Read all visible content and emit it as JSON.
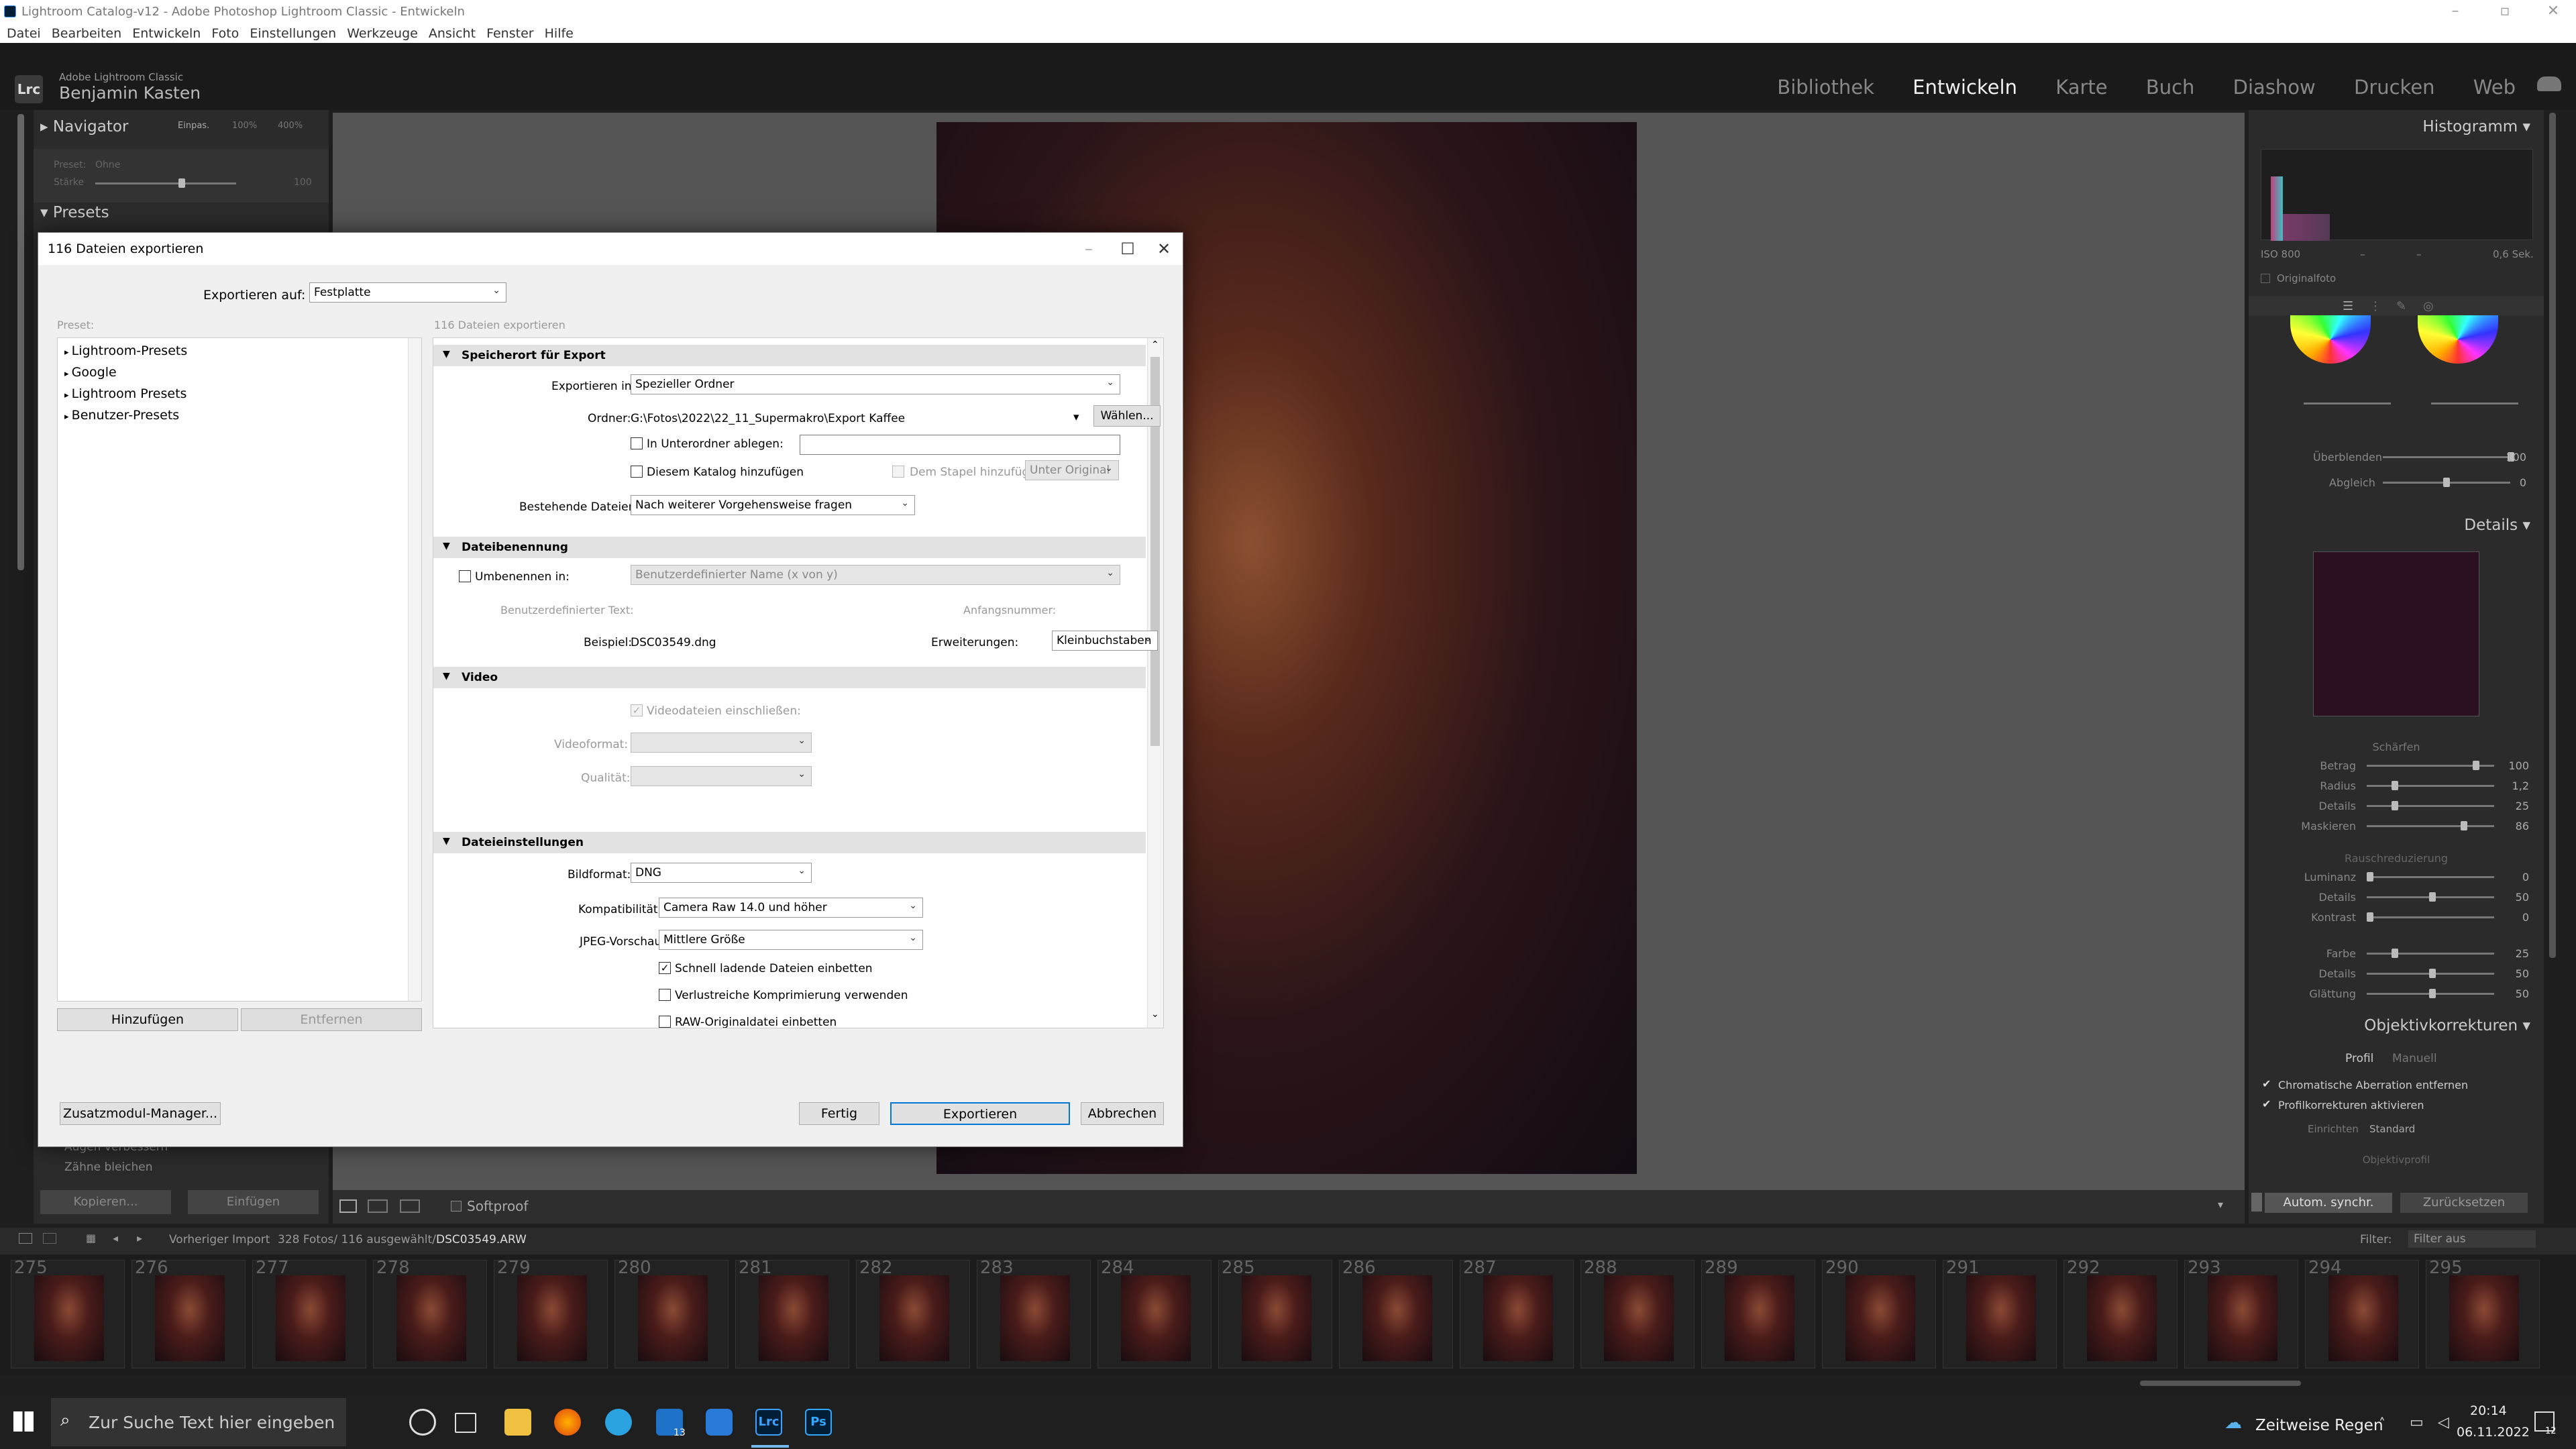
{
  "window": {
    "title": "Lightroom Catalog-v12 - Adobe Photoshop Lightroom Classic - Entwickeln"
  },
  "menu": [
    "Datei",
    "Bearbeiten",
    "Entwickeln",
    "Foto",
    "Einstellungen",
    "Werkzeuge",
    "Ansicht",
    "Fenster",
    "Hilfe"
  ],
  "identity": {
    "logo": "Lrc",
    "app": "Adobe Lightroom Classic",
    "user": "Benjamin Kasten"
  },
  "modules": {
    "items": [
      "Bibliothek",
      "Entwickeln",
      "Karte",
      "Buch",
      "Diashow",
      "Drucken",
      "Web"
    ],
    "active": "Entwickeln"
  },
  "left_panel": {
    "navigator": "Navigator",
    "nav_zoom": [
      "Einpas.",
      "100%",
      "400%"
    ],
    "preset_label": "Preset:",
    "preset_value": "Ohne",
    "amount_label": "Stärke",
    "amount_value": "100",
    "presets": "Presets",
    "history": [
      "Augen verbessern",
      "Zähne bleichen"
    ],
    "copy_button": "Kopieren...",
    "paste_button": "Einfügen"
  },
  "toolbar": {
    "softproof": "Softproof"
  },
  "right_panel": {
    "histogram": "Histogramm",
    "histo_info": [
      "ISO 800",
      "–",
      "–",
      "0,6 Sek."
    ],
    "originalfoto": "Originalfoto",
    "blend_label": "Überblenden",
    "blend_value": "100",
    "balance_label": "Abgleich",
    "balance_value": "0",
    "details": "Details",
    "sharpening": {
      "title": "Schärfen",
      "rows": [
        {
          "label": "Betrag",
          "value": "100"
        },
        {
          "label": "Radius",
          "value": "1,2"
        },
        {
          "label": "Details",
          "value": "25"
        },
        {
          "label": "Maskieren",
          "value": "86"
        }
      ]
    },
    "noise": {
      "title": "Rauschreduzierung",
      "rows": [
        {
          "label": "Luminanz",
          "value": "0"
        },
        {
          "label": "Details",
          "value": "50"
        },
        {
          "label": "Kontrast",
          "value": "0"
        },
        {
          "label": "Farbe",
          "value": "25"
        },
        {
          "label": "Details",
          "value": "50"
        },
        {
          "label": "Glättung",
          "value": "50"
        }
      ]
    },
    "lens": "Objektivkorrekturen",
    "lens_tabs": [
      "Profil",
      "Manuell"
    ],
    "lens_checks": [
      "Chromatische Aberration entfernen",
      "Profilkorrekturen aktivieren"
    ],
    "setup_label": "Einrichten",
    "setup_value": "Standard",
    "lens_profile": "Objektivprofil",
    "sync_button": "Autom. synchr.",
    "reset_button": "Zurücksetzen"
  },
  "filmstrip": {
    "source": "Vorheriger Import",
    "count": "328 Fotos/ 116 ausgewählt/",
    "file": "DSC03549.ARW",
    "filter_label": "Filter:",
    "filter_value": "Filter aus",
    "numbers": [
      "275",
      "276",
      "277",
      "278",
      "279",
      "280",
      "281",
      "282",
      "283",
      "284",
      "285",
      "286",
      "287",
      "288",
      "289",
      "290",
      "291",
      "292",
      "293",
      "294",
      "295"
    ]
  },
  "taskbar": {
    "search_placeholder": "Zur Suche Text hier eingeben",
    "weather": "Zeitweise Regen",
    "time": "20:14",
    "date": "06.11.2022",
    "mail_badge": "13",
    "notif_badge": "12"
  },
  "dialog": {
    "title": "116 Dateien exportieren",
    "export_to_label": "Exportieren auf:",
    "export_to_value": "Festplatte",
    "preset_label": "Preset:",
    "subtitle": "116 Dateien exportieren",
    "presets": [
      "Lightroom-Presets",
      "Google",
      "Lightroom Presets",
      "Benutzer-Presets"
    ],
    "add_button": "Hinzufügen",
    "remove_button": "Entfernen",
    "plugin_button": "Zusatzmodul-Manager...",
    "done_button": "Fertig",
    "export_button": "Exportieren",
    "cancel_button": "Abbrechen",
    "location": {
      "title": "Speicherort für Export",
      "export_in_label": "Exportieren in:",
      "export_in_value": "Spezieller Ordner",
      "folder_label": "Ordner:",
      "folder_value": "G:\\Fotos\\2022\\22_11_Supermakro\\Export Kaffee",
      "choose_button": "Wählen...",
      "subfolder_label": "In Unterordner ablegen:",
      "catalog_label": "Diesem Katalog hinzufügen",
      "stack_label": "Dem Stapel hinzufügen:",
      "stack_value": "Unter Original",
      "existing_label": "Bestehende Dateien:",
      "existing_value": "Nach weiterer Vorgehensweise fragen"
    },
    "naming": {
      "title": "Dateibenennung",
      "rename_label": "Umbenennen in:",
      "rename_value": "Benutzerdefinierter Name (x von y)",
      "custom_text_label": "Benutzerdefinierter Text:",
      "start_number_label": "Anfangsnummer:",
      "example_label": "Beispiel:",
      "example_value": "DSC03549.dng",
      "extensions_label": "Erweiterungen:",
      "extensions_value": "Kleinbuchstaben"
    },
    "video": {
      "title": "Video",
      "include_label": "Videodateien einschließen:",
      "format_label": "Videoformat:",
      "quality_label": "Qualität:"
    },
    "file_settings": {
      "title": "Dateieinstellungen",
      "format_label": "Bildformat:",
      "format_value": "DNG",
      "compat_label": "Kompatibilität:",
      "compat_value": "Camera Raw 14.0 und höher",
      "jpeg_label": "JPEG-Vorschau:",
      "jpeg_value": "Mittlere Größe",
      "checks": [
        "Schnell ladende Dateien einbetten",
        "Verlustreiche Komprimierung verwenden",
        "RAW-Originaldatei einbetten"
      ]
    }
  }
}
